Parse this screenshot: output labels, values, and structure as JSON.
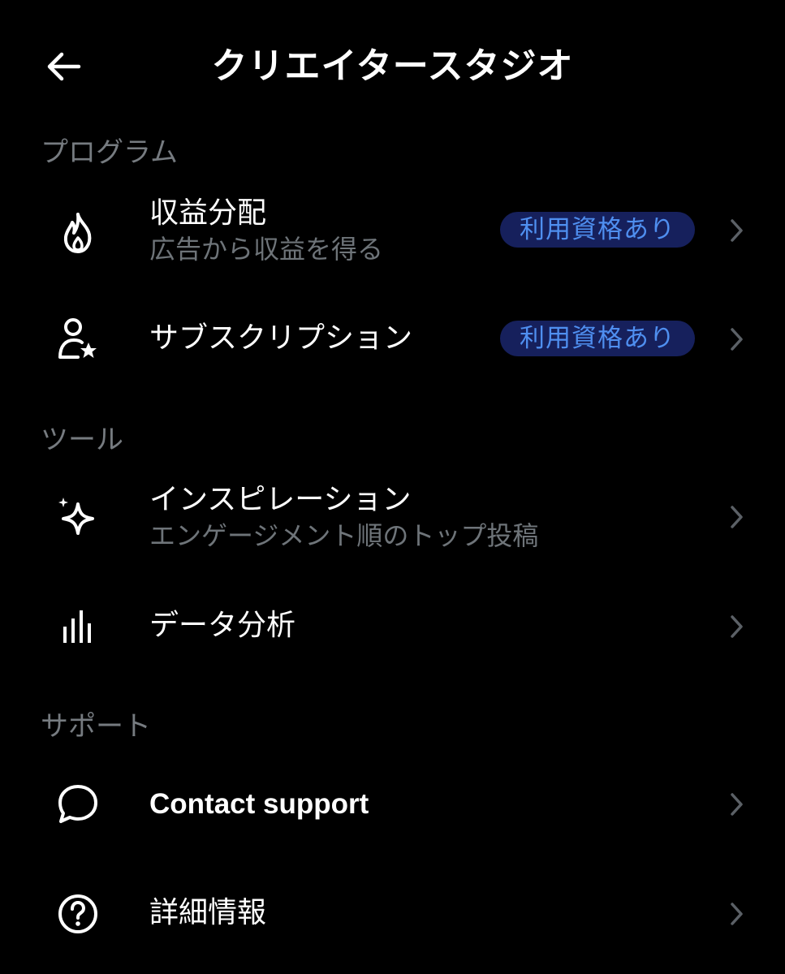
{
  "header": {
    "back_icon": "arrow-left-icon",
    "title": "クリエイタースタジオ"
  },
  "sections": [
    {
      "heading": "プログラム",
      "items": [
        {
          "icon": "flame-icon",
          "title": "収益分配",
          "subtitle": "広告から収益を得る",
          "badge": "利用資格あり"
        },
        {
          "icon": "person-star-icon",
          "title": "サブスクリプション",
          "badge": "利用資格あり"
        }
      ]
    },
    {
      "heading": "ツール",
      "items": [
        {
          "icon": "sparkle-icon",
          "title": "インスピレーション",
          "subtitle": "エンゲージメント順のトップ投稿"
        },
        {
          "icon": "bar-chart-icon",
          "title": "データ分析"
        }
      ]
    },
    {
      "heading": "サポート",
      "items": [
        {
          "icon": "chat-bubble-icon",
          "title": "Contact support"
        },
        {
          "icon": "question-circle-icon",
          "title": "詳細情報"
        }
      ]
    }
  ],
  "colors": {
    "background": "#000000",
    "text_primary": "#ffffff",
    "text_secondary": "#6e7479",
    "section_heading": "#767b80",
    "badge_bg": "#16205c",
    "badge_text": "#4f8ff0",
    "chevron": "#5b6066"
  }
}
